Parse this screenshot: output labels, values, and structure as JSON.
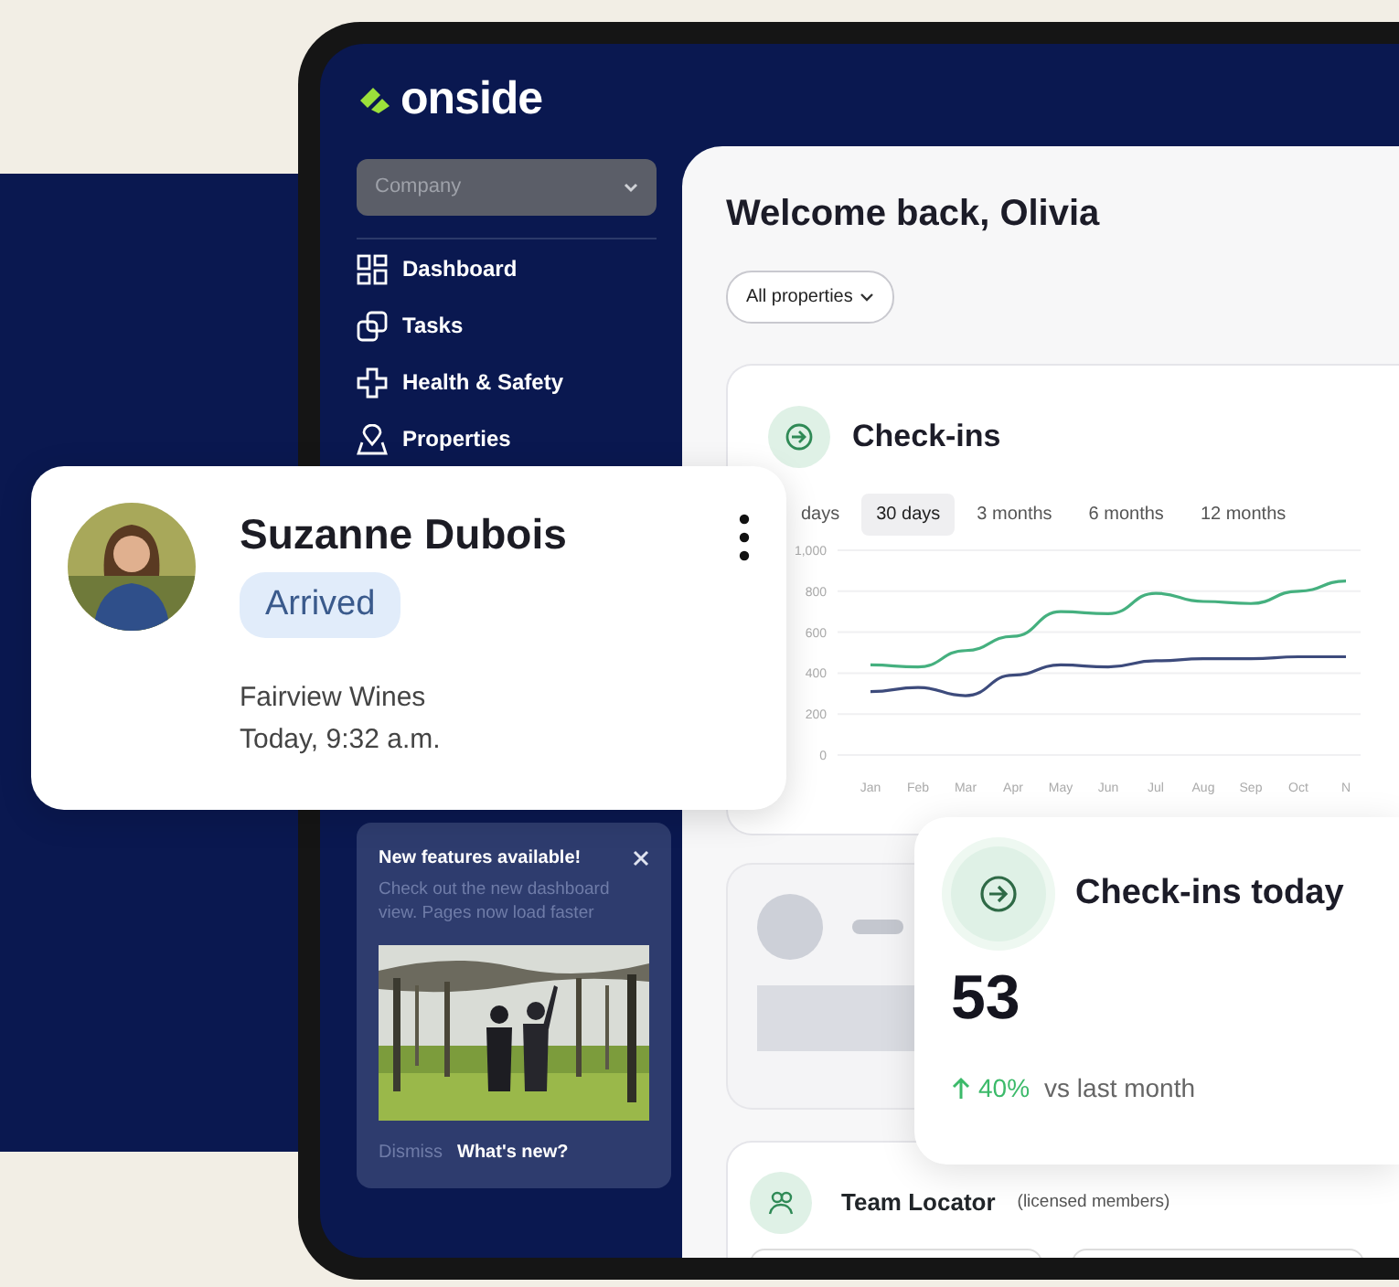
{
  "brand": {
    "name": "onside"
  },
  "sidebar": {
    "company_select": {
      "placeholder": "Company"
    },
    "items": [
      {
        "label": "Dashboard",
        "kind": "dashboard"
      },
      {
        "label": "Tasks",
        "kind": "tasks"
      },
      {
        "label": "Health & Safety",
        "kind": "health"
      },
      {
        "label": "Properties",
        "kind": "properties"
      }
    ],
    "promo": {
      "title": "New features available!",
      "text": "Check out the new dashboard view. Pages now load faster",
      "dismiss": "Dismiss",
      "link": "What's new?"
    }
  },
  "header": {
    "title": "Welcome back, Olivia",
    "filter": "All properties"
  },
  "checkins": {
    "title": "Check-ins",
    "ranges": [
      {
        "label": "days",
        "selected": false
      },
      {
        "label": "30 days",
        "selected": true
      },
      {
        "label": "3 months",
        "selected": false
      },
      {
        "label": "6 months",
        "selected": false
      },
      {
        "label": "12 months",
        "selected": false
      }
    ],
    "chart_data": {
      "type": "line",
      "grid": true,
      "categories": [
        "Jan",
        "Feb",
        "Mar",
        "Apr",
        "May",
        "Jun",
        "Jul",
        "Aug",
        "Sep",
        "Oct",
        "N"
      ],
      "ylim": [
        0,
        1000
      ],
      "yticks": [
        0,
        200,
        400,
        600,
        800,
        {
          "value": 1000,
          "label": "1,000"
        }
      ],
      "series": [
        {
          "color": "#45b07f",
          "values": [
            440,
            430,
            510,
            580,
            700,
            690,
            790,
            750,
            740,
            800,
            850
          ]
        },
        {
          "color": "#3d4b7c",
          "values": [
            310,
            330,
            290,
            390,
            440,
            430,
            460,
            470,
            470,
            480,
            480
          ]
        }
      ]
    }
  },
  "today": {
    "title": "Check-ins today",
    "value": "53",
    "rising": true,
    "change": "40%",
    "comparison": "vs last month"
  },
  "team_locator": {
    "title": "Team Locator",
    "note": "(licensed members)"
  },
  "person_card": {
    "name": "Suzanne Dubois",
    "status": "Arrived",
    "place": "Fairview Wines",
    "time": "Today, 9:32 a.m."
  }
}
